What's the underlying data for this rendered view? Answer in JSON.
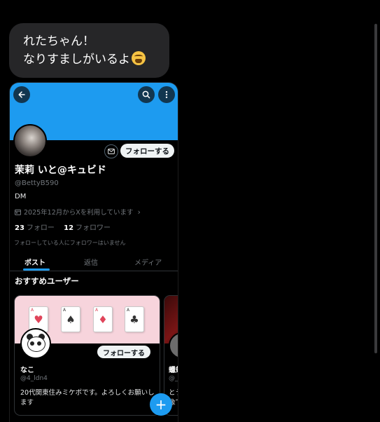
{
  "message": {
    "line1": "れたちゃん！",
    "line2": "なりすましがいるよ",
    "emoji": "weary-face-emoji"
  },
  "profile": {
    "back_icon": "arrow-left-icon",
    "search_icon": "search-icon",
    "more_icon": "more-vertical-icon",
    "mail_icon": "mail-icon",
    "follow_label": "フォローする",
    "display_name": "茉莉 いと@キュビド",
    "handle": "@BettyB590",
    "bio": "DM",
    "joined": "2025年12月からXを利用しています",
    "following_count": "23",
    "following_label": "フォロー",
    "followers_count": "12",
    "followers_label": "フォロワー",
    "mutual_note": "フォローしている人にフォロワーはいません",
    "banner_color": "#1d9bf0"
  },
  "tabs": [
    {
      "label": "ポスト",
      "active": true
    },
    {
      "label": "返信",
      "active": false
    },
    {
      "label": "メディア",
      "active": false
    }
  ],
  "recommended": {
    "title": "おすすめユーザー",
    "cards": [
      {
        "name": "なこ",
        "handle": "@4_ldn4",
        "bio": "20代関東住みミケポです。よろしくお願いします",
        "follow_label": "フォローする"
      },
      {
        "name": "蠟蛹",
        "handle": "@_",
        "bio": "とう\n像で"
      }
    ]
  },
  "fab": {
    "label": "+"
  }
}
